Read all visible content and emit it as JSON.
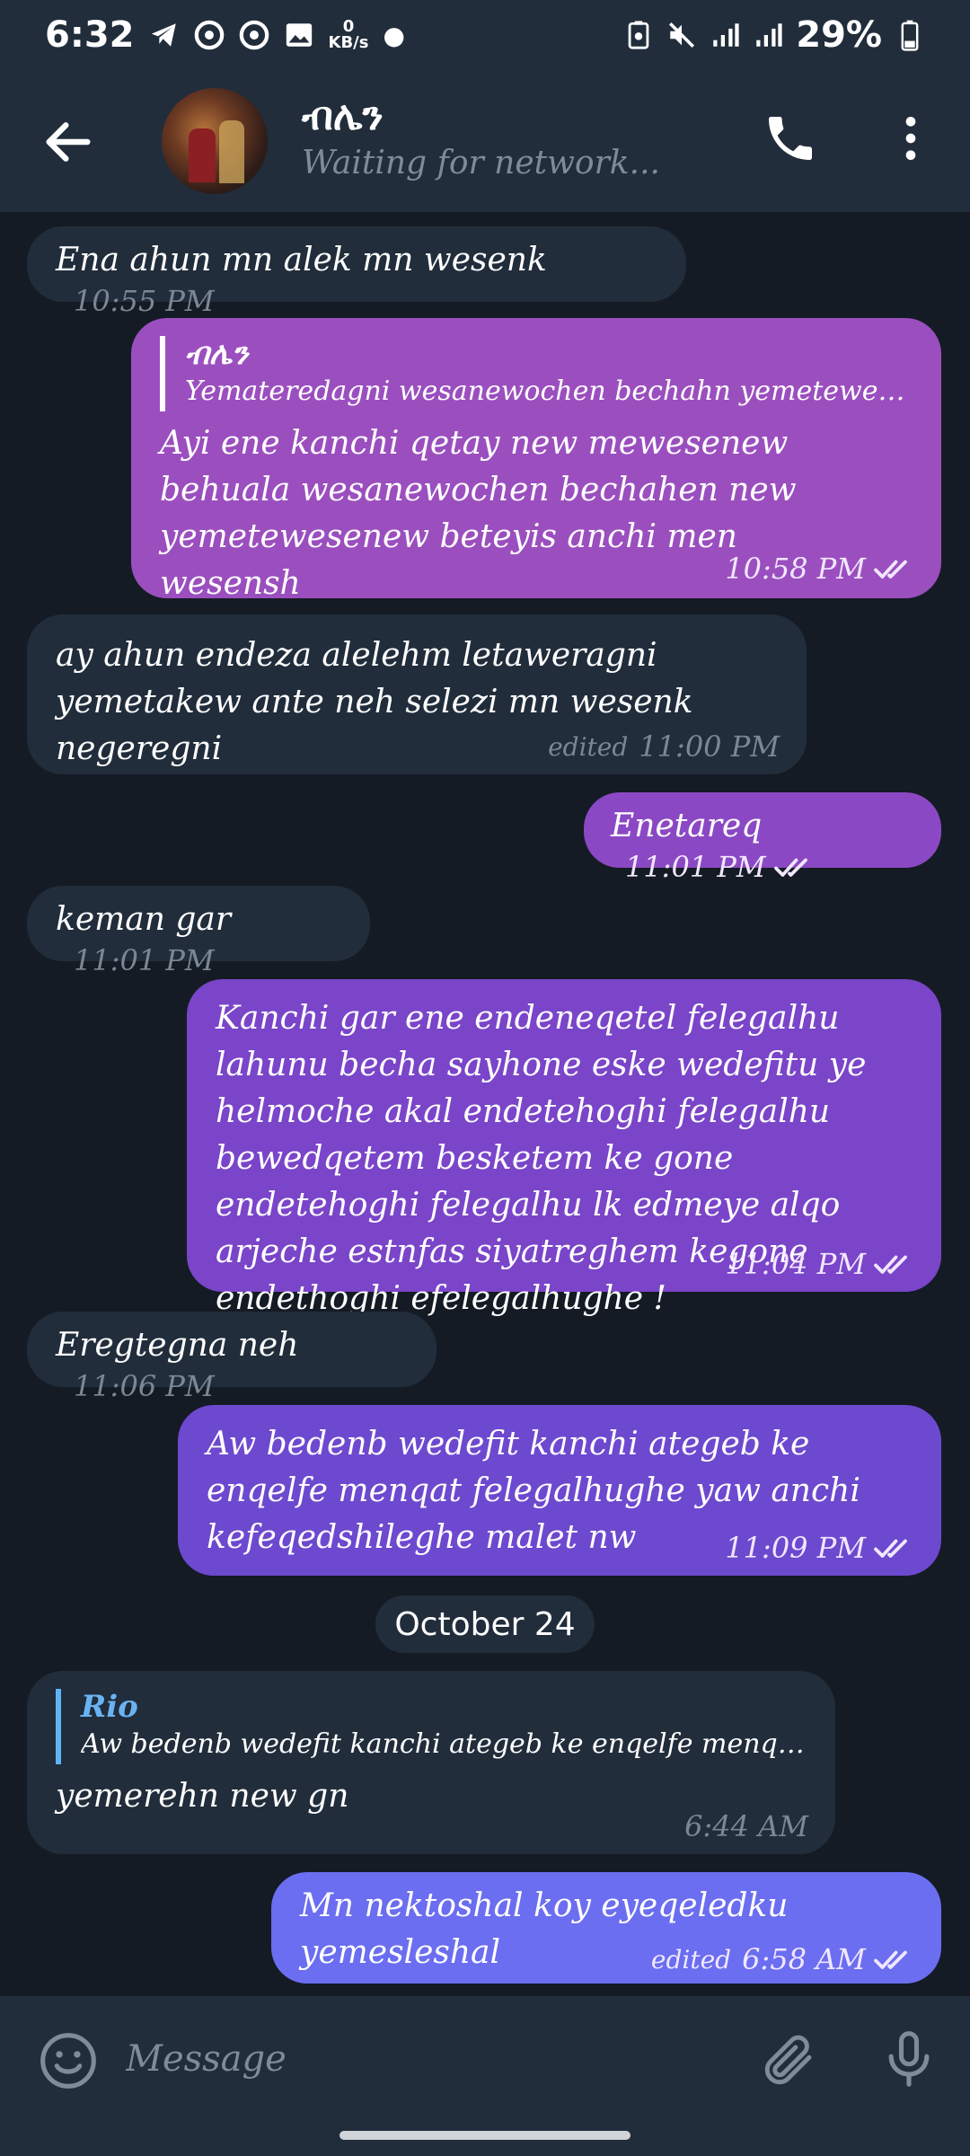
{
  "status_bar": {
    "time": "6:32",
    "net_speed_value": "0",
    "net_speed_unit": "KB/s",
    "battery": "29%"
  },
  "header": {
    "title": "ብሌን",
    "subtitle": "Waiting for network..."
  },
  "messages": [
    {
      "id": "m1",
      "direction": "incoming",
      "text": "Ena ahun mn alek mn wesenk",
      "time": "10:55 PM"
    },
    {
      "id": "m2",
      "direction": "outgoing",
      "reply_to": {
        "name": "ብሌን",
        "text": "Yemateredagni wesanewochen bechahn yemetewesen k..."
      },
      "text": "Ayi ene kanchi qetay new mewesenew behuala wesanewochen bechahen new yemetewesenew beteyis anchi men wesensh",
      "time": "10:58 PM",
      "read": true,
      "color": "#9b4fbf"
    },
    {
      "id": "m3",
      "direction": "incoming",
      "text": "ay ahun endeza alelehm letaweragni yemetakew ante neh selezi mn wesenk negeregni",
      "edited_label": "edited",
      "time": "11:00 PM"
    },
    {
      "id": "m4",
      "direction": "outgoing",
      "text": "Enetareq",
      "time": "11:01 PM",
      "read": true,
      "color": "#8b48c4"
    },
    {
      "id": "m5",
      "direction": "incoming",
      "text": "keman gar",
      "time": "11:01 PM"
    },
    {
      "id": "m6",
      "direction": "outgoing",
      "text": "Kanchi gar ene endeneqetel felegalhu lahunu becha sayhone eske wedefitu  ye helmoche akal endetehoghi felegalhu bewedqetem besketem ke gone endetehoghi felegalhu lk edmeye alqo arjeche estnfas siyatreghem kegone endethoghi efelegalhughe !",
      "time": "11:04 PM",
      "read": true,
      "color": "#7a45c9"
    },
    {
      "id": "m7",
      "direction": "incoming",
      "text": "Eregtegna neh",
      "time": "11:06 PM"
    },
    {
      "id": "m8",
      "direction": "outgoing",
      "text": "Aw bedenb wedefit kanchi ategeb ke enqelfe menqat felegalhughe yaw anchi kefeqedshileghe malet nw",
      "time": "11:09 PM",
      "read": true,
      "color": "#6d49cf"
    },
    {
      "id": "m9",
      "direction": "incoming",
      "reply_to": {
        "name": "Rio",
        "text": "Aw bedenb wedefit kanchi ategeb ke enqelfe menqat f..."
      },
      "text": "yemerehn new gn",
      "time": "6:44 AM"
    },
    {
      "id": "m10",
      "direction": "outgoing",
      "text": "Mn nektoshal koy eyeqeledku yemesleshal",
      "edited_label": "edited",
      "time": "6:58 AM",
      "read": true,
      "color": "#6b6ef0"
    }
  ],
  "date_separator": "October 24",
  "input": {
    "placeholder": "Message"
  },
  "colors": {
    "background": "#141b24",
    "bar": "#212d3b",
    "incoming_bubble": "#212d3b",
    "muted_text": "#7f8b98"
  }
}
